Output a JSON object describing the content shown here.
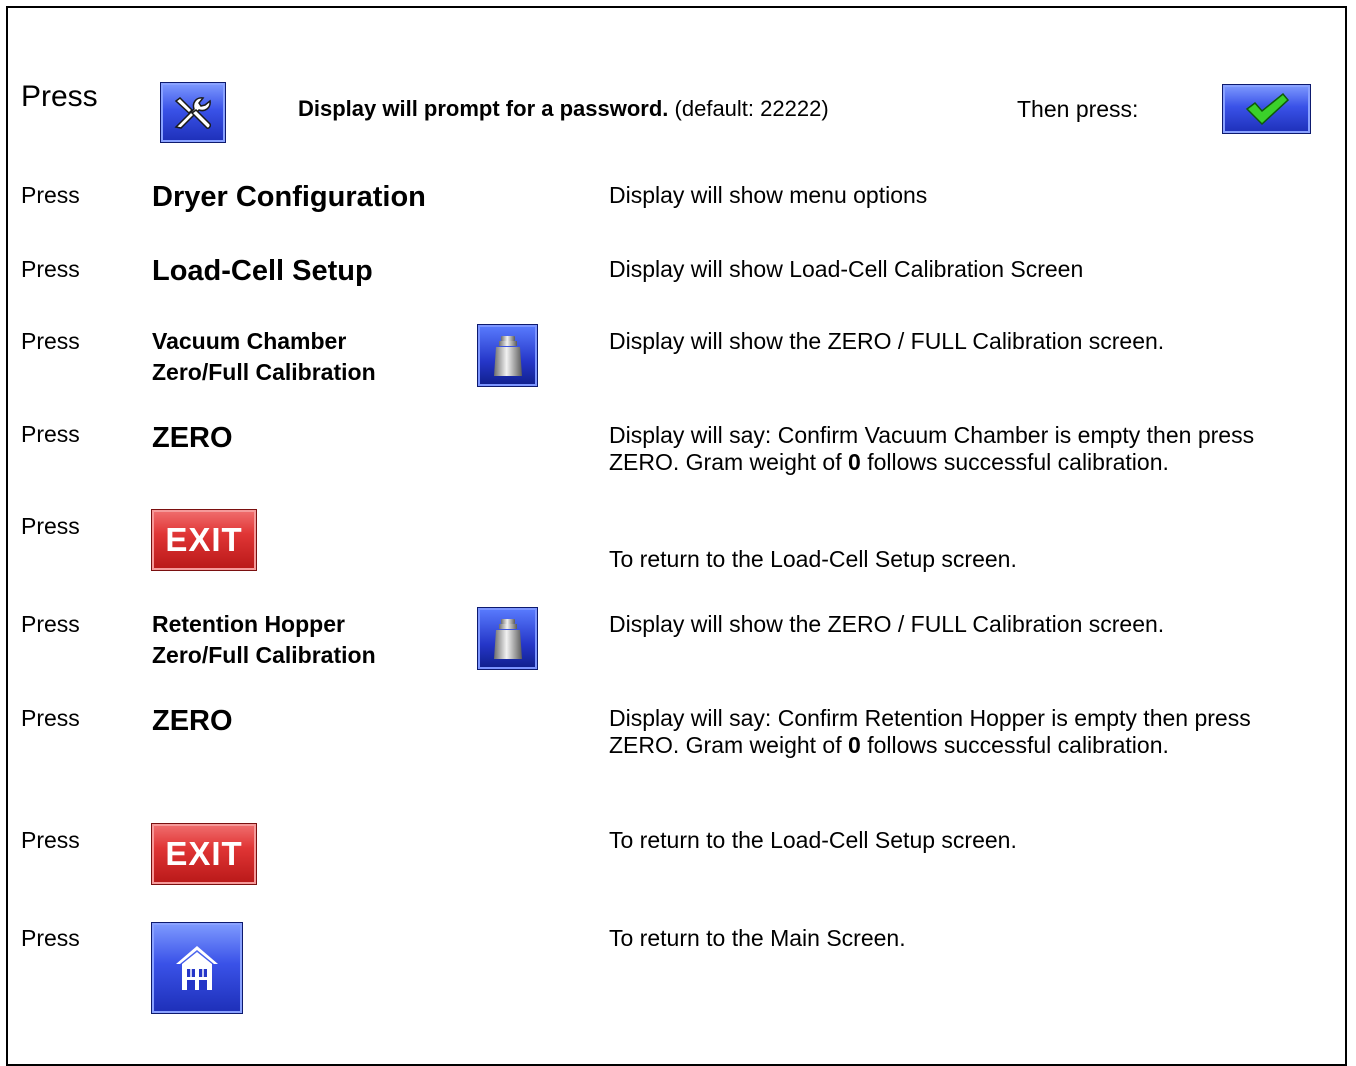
{
  "press_label": "Press",
  "step1": {
    "instruction_bold": "Display will prompt for a password.",
    "instruction_default": "(default: 22222)",
    "then_press": "Then press:"
  },
  "step2": {
    "target": "Dryer Configuration",
    "description": "Display will show menu options"
  },
  "step3": {
    "target": "Load-Cell Setup",
    "description": "Display will show Load-Cell Calibration Screen"
  },
  "step4": {
    "target_line1": "Vacuum Chamber",
    "target_line2": "Zero/Full Calibration",
    "description": "Display will show the ZERO / FULL Calibration screen."
  },
  "step5": {
    "target": "ZERO",
    "desc_part1": "Display will say: Confirm Vacuum Chamber is empty then press ZERO.   Gram weight of ",
    "desc_bold": "0",
    "desc_part2": " follows successful calibration."
  },
  "step6": {
    "button_label": "EXIT",
    "description": "To return to the Load-Cell Setup screen."
  },
  "step7": {
    "target_line1": "Retention Hopper",
    "target_line2": "Zero/Full Calibration",
    "description": "Display will show the ZERO / FULL Calibration screen."
  },
  "step8": {
    "target": "ZERO",
    "desc_part1": "Display will say: Confirm Retention Hopper is empty then press ZERO.   Gram weight of ",
    "desc_bold": "0",
    "desc_part2": " follows successful calibration."
  },
  "step9": {
    "button_label": "EXIT",
    "description": "To return to the Load-Cell Setup screen."
  },
  "step10": {
    "description": "To return to the Main Screen."
  },
  "icons": {
    "setup": "tools-icon",
    "confirm": "checkmark-icon",
    "weight": "weight-icon",
    "home": "home-icon"
  },
  "colors": {
    "button_blue": "#3a52e8",
    "button_exit": "#e03535",
    "check_green": "#3bd12a"
  }
}
